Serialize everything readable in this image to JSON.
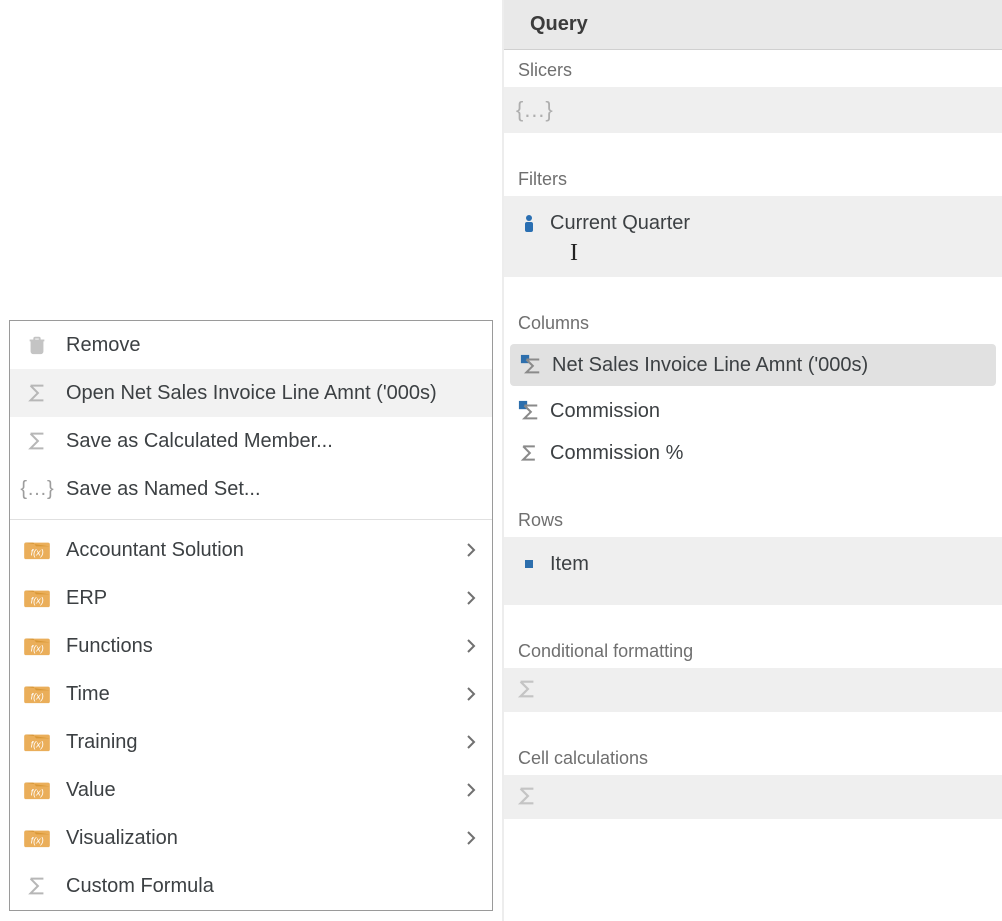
{
  "panel": {
    "title": "Query",
    "sections": {
      "slicers": {
        "label": "Slicers"
      },
      "filters": {
        "label": "Filters",
        "items": [
          "Current Quarter"
        ]
      },
      "columns": {
        "label": "Columns",
        "items": [
          "Net Sales Invoice Line Amnt ('000s)",
          "Commission",
          "Commission %"
        ],
        "selected_index": 0
      },
      "rows": {
        "label": "Rows",
        "items": [
          "Item"
        ]
      },
      "condfmt": {
        "label": "Conditional formatting"
      },
      "cellcalc": {
        "label": "Cell calculations"
      }
    }
  },
  "menu": {
    "remove": "Remove",
    "open": "Open Net Sales Invoice Line Amnt ('000s)",
    "savecalc": "Save as Calculated Member...",
    "saveset": "Save as Named Set...",
    "folders": [
      "Accountant Solution",
      "ERP",
      "Functions",
      "Time",
      "Training",
      "Value",
      "Visualization"
    ],
    "custom": "Custom Formula"
  }
}
